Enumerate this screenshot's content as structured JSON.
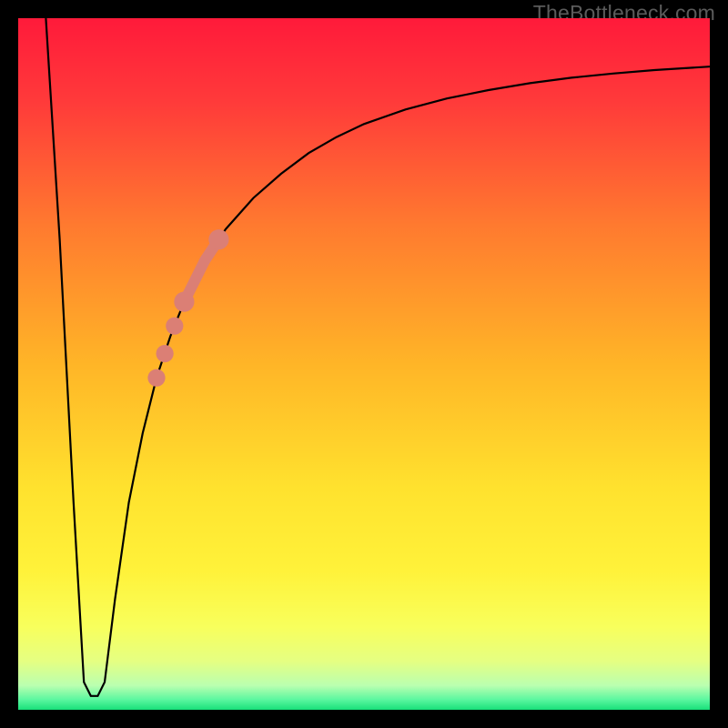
{
  "watermark": "TheBottleneck.com",
  "colors": {
    "frame": "#000000",
    "curve_stroke": "#000000",
    "marker_fill": "#db7f75",
    "gradient_stops": [
      {
        "offset": 0.0,
        "color": "#ff1a3a"
      },
      {
        "offset": 0.12,
        "color": "#ff3a3a"
      },
      {
        "offset": 0.3,
        "color": "#ff7a2f"
      },
      {
        "offset": 0.5,
        "color": "#ffb527"
      },
      {
        "offset": 0.68,
        "color": "#ffe22e"
      },
      {
        "offset": 0.8,
        "color": "#fff23a"
      },
      {
        "offset": 0.88,
        "color": "#f8ff5c"
      },
      {
        "offset": 0.93,
        "color": "#e5ff82"
      },
      {
        "offset": 0.965,
        "color": "#baffb0"
      },
      {
        "offset": 0.985,
        "color": "#5cf7a0"
      },
      {
        "offset": 1.0,
        "color": "#18e07a"
      }
    ]
  },
  "chart_data": {
    "type": "line",
    "title": "",
    "xlabel": "",
    "ylabel": "",
    "xlim": [
      0,
      100
    ],
    "ylim": [
      0,
      100
    ],
    "series": [
      {
        "name": "bottleneck-curve",
        "x": [
          4,
          6,
          8,
          9.5,
          10.5,
          11.5,
          12.5,
          14,
          16,
          18,
          20,
          22,
          24,
          26,
          28,
          30,
          34,
          38,
          42,
          46,
          50,
          56,
          62,
          68,
          74,
          80,
          86,
          92,
          100
        ],
        "y": [
          100,
          68,
          30,
          4,
          2,
          2,
          4,
          16,
          30,
          40,
          48,
          54,
          59,
          63,
          66.5,
          69.5,
          74,
          77.5,
          80.5,
          82.8,
          84.7,
          86.8,
          88.4,
          89.6,
          90.6,
          91.4,
          92,
          92.5,
          93
        ]
      }
    ],
    "markers": [
      {
        "name": "highlight-point",
        "x": 20.0,
        "y": 48.0,
        "r": 1.2
      },
      {
        "name": "highlight-point",
        "x": 21.2,
        "y": 51.5,
        "r": 1.2
      },
      {
        "name": "highlight-point",
        "x": 22.6,
        "y": 55.5,
        "r": 1.2
      },
      {
        "name": "highlight-segment-start",
        "x": 24.0,
        "y": 59.0,
        "r": 1.6
      },
      {
        "name": "highlight-segment-end",
        "x": 29.0,
        "y": 68.0,
        "r": 1.6
      }
    ],
    "highlight_segment": {
      "x": [
        24.0,
        25.5,
        27.0,
        28.0,
        29.0
      ],
      "y": [
        59.0,
        62.0,
        65.0,
        66.5,
        68.0
      ]
    }
  }
}
